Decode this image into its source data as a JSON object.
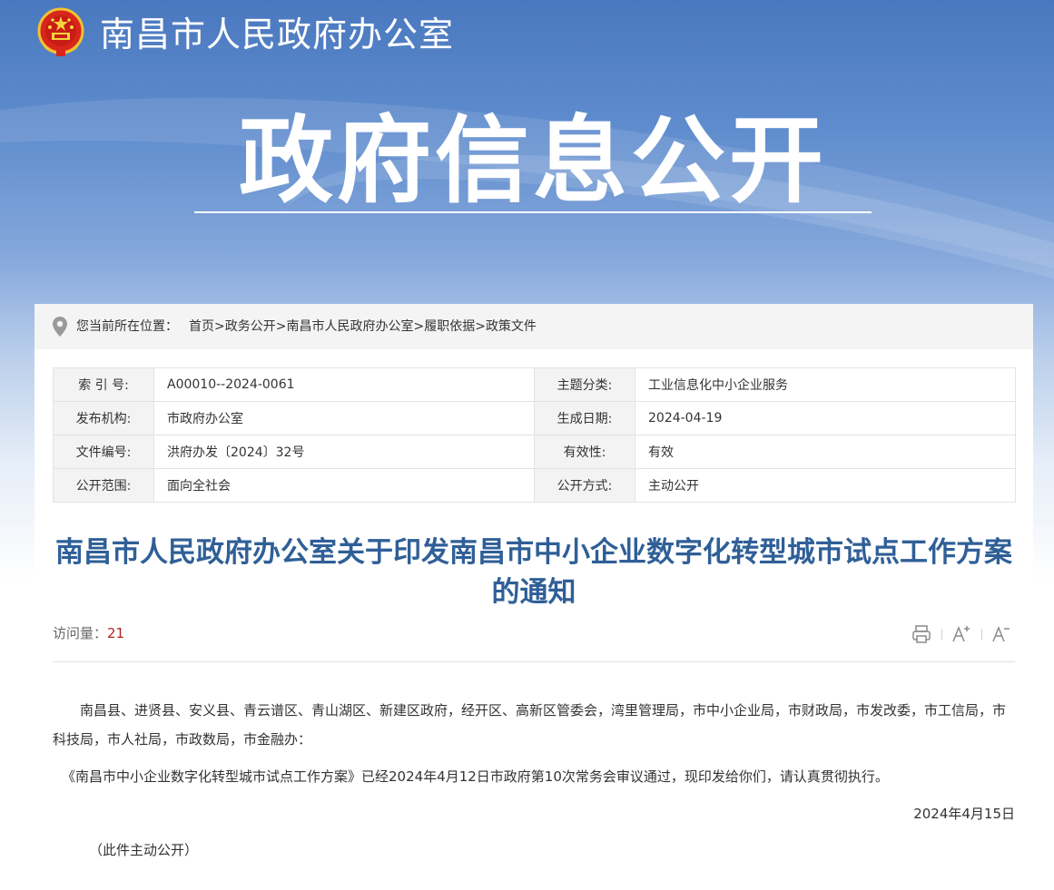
{
  "header": {
    "org_name": "南昌市人民政府办公室",
    "section_title": "政府信息公开"
  },
  "breadcrumb": {
    "prefix": "您当前所在位置：",
    "items": [
      "首页",
      "政务公开",
      "南昌市人民政府办公室",
      "履职依据",
      "政策文件"
    ],
    "separator": ">"
  },
  "meta": {
    "rows": [
      {
        "l1": "索 引 号:",
        "v1": "A00010--2024-0061",
        "l2": "主题分类:",
        "v2": "工业信息化中小企业服务"
      },
      {
        "l1": "发布机构:",
        "v1": "市政府办公室",
        "l2": "生成日期:",
        "v2": "2024-04-19"
      },
      {
        "l1": "文件编号:",
        "v1": "洪府办发〔2024〕32号",
        "l2": "有效性:",
        "v2": "有效"
      },
      {
        "l1": "公开范围:",
        "v1": "面向全社会",
        "l2": "公开方式:",
        "v2": "主动公开"
      }
    ]
  },
  "article": {
    "title": "南昌市人民政府办公室关于印发南昌市中小企业数字化转型城市试点工作方案的通知",
    "visits_label": "访问量：",
    "visits_count": "21",
    "tools": {
      "print_icon": "printer-icon",
      "font_up_icon": "font-increase-icon",
      "font_down_icon": "font-decrease-icon"
    },
    "paragraph1": "南昌县、进贤县、安义县、青云谱区、青山湖区、新建区政府，经开区、高新区管委会，湾里管理局，市中小企业局，市财政局，市发改委，市工信局，市科技局，市人社局，市政数局，市金融办：",
    "paragraph2": "《南昌市中小企业数字化转型城市试点工作方案》已经2024年4月12日市政府第10次常务会审议通过，现印发给你们，请认真贯彻执行。",
    "date": "2024年4月15日",
    "note": "（此件主动公开）"
  },
  "colors": {
    "title_blue": "#2f5f97",
    "banner_blue": "#4a78bf",
    "visits_red": "#b22222"
  }
}
